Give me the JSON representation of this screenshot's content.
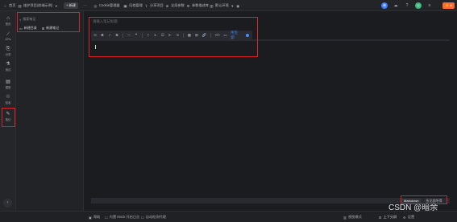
{
  "topbar": {
    "home_label": "首页",
    "workspace_label": "维护项目(前端示例)",
    "new_label": "+ 新建",
    "more_icon": "more-icon",
    "tools": [
      "Cookie管理器",
      "归档管理",
      "分享项目",
      "全局参数",
      "参数描述库",
      "默认环境"
    ]
  },
  "rail": {
    "items": [
      {
        "label": "首页",
        "icon": "home-icon"
      },
      {
        "label": "APIs",
        "icon": "api-icon"
      },
      {
        "label": "分享",
        "icon": "share-icon"
      },
      {
        "label": "测试",
        "icon": "test-icon"
      },
      {
        "label": "模型",
        "icon": "model-icon"
      },
      {
        "label": "回收",
        "icon": "recycle-icon"
      },
      {
        "label": "笔记",
        "icon": "note-icon"
      }
    ]
  },
  "panel": {
    "search_placeholder": "搜索笔记",
    "new_folder": "新建目录",
    "new_note": "新建笔记"
  },
  "editor": {
    "title_placeholder": "请输入笔记标题",
    "toolbar": [
      "H",
      "B",
      "I",
      "S",
      "—",
      "❝",
      "•",
      "1.",
      "☑",
      "⇤",
      "⇥",
      "▦",
      "⊞",
      "🔗",
      "</>",
      "▭"
    ],
    "mode_label": "所见即",
    "tabs": {
      "markdown": "Markdown",
      "wysiwyg": "所见即所得"
    }
  },
  "status": {
    "left": "帮助",
    "items": [
      "内置 Mock 开启日志",
      "自动检测代理"
    ],
    "right_items": [
      "视图模式",
      "上下分屏",
      "设置"
    ],
    "watermark": "CSDN @暗余"
  },
  "colors": {
    "accent": "#4a8cff",
    "upgrade": "#ff6a33",
    "highlight": "#d9232c"
  }
}
